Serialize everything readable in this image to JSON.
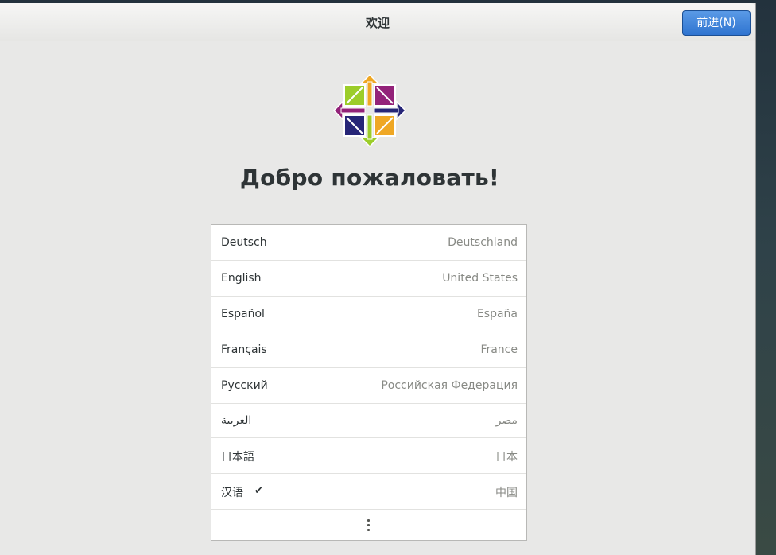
{
  "window": {
    "title": "欢迎",
    "next_button_label": "前进(N)"
  },
  "logo": {
    "icon": "centos-logo-icon",
    "colors": [
      "#9ccd2a",
      "#932279",
      "#efa724",
      "#262577"
    ]
  },
  "welcome_heading": "Добро пожаловать!",
  "languages": [
    {
      "name": "Deutsch",
      "region": "Deutschland",
      "selected": false
    },
    {
      "name": "English",
      "region": "United States",
      "selected": false
    },
    {
      "name": "Español",
      "region": "España",
      "selected": false
    },
    {
      "name": "Français",
      "region": "France",
      "selected": false
    },
    {
      "name": "Русский",
      "region": "Российская Федерация",
      "selected": false
    },
    {
      "name": "العربية",
      "region": "مصر",
      "selected": false
    },
    {
      "name": "日本語",
      "region": "日本",
      "selected": false
    },
    {
      "name": "汉语",
      "region": "中国",
      "selected": true
    }
  ],
  "more": {
    "icon": "more-options-icon"
  },
  "colors": {
    "accent": "#3379d4",
    "window_bg": "#e8e8e7",
    "list_bg": "#ffffff"
  }
}
